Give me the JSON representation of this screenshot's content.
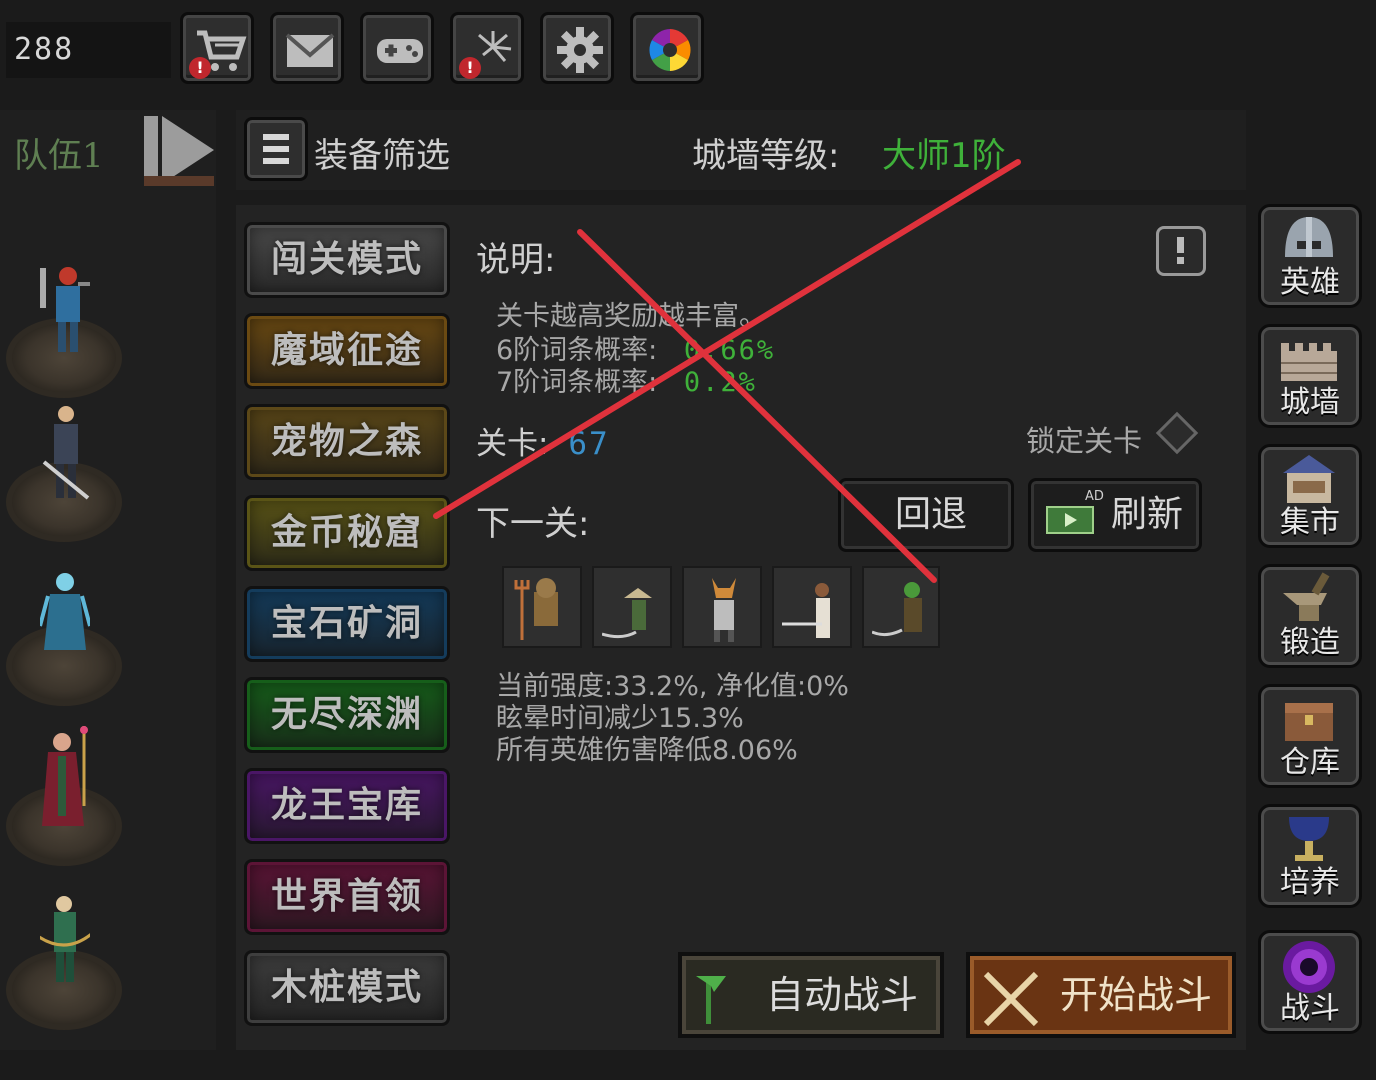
{
  "top": {
    "coins": "288",
    "buttons": [
      {
        "icon": "shop-cart-icon",
        "alert": "!"
      },
      {
        "icon": "mail-icon"
      },
      {
        "icon": "gamepad-icon"
      },
      {
        "icon": "fireworks-icon",
        "alert": "!"
      },
      {
        "icon": "gear-icon"
      },
      {
        "icon": "color-wheel-icon"
      }
    ]
  },
  "team": {
    "label": "队伍1"
  },
  "header": {
    "filter_label": "装备筛选",
    "wall_label": "城墙等级:",
    "wall_value": "大师1阶"
  },
  "modes": [
    {
      "label": "闯关模式",
      "color": "#4a4a4a"
    },
    {
      "label": "魔域征途",
      "color": "#6b4a12"
    },
    {
      "label": "宠物之森",
      "color": "#5c4818"
    },
    {
      "label": "金币秘窟",
      "color": "#5a5416"
    },
    {
      "label": "宝石矿洞",
      "color": "#143c5c"
    },
    {
      "label": "无尽深渊",
      "color": "#165e1a"
    },
    {
      "label": "龙王宝库",
      "color": "#4a1666"
    },
    {
      "label": "世界首领",
      "color": "#5c1436"
    },
    {
      "label": "木桩模式",
      "color": "#3e3e3e"
    }
  ],
  "info": {
    "title": "说明:",
    "line1": "关卡越高奖励越丰富。",
    "line2_label": "6阶词条概率:",
    "line2_value": "0.66%",
    "line3_label": "7阶词条概率:",
    "line3_value": "0.2%",
    "level_label": "关卡:",
    "level_value": "67",
    "lock_label": "锁定关卡",
    "next_label": "下一关:",
    "back_button": "回退",
    "refresh_button": "刷新",
    "ad_badge": "AD",
    "stat1": "当前强度:33.2%, 净化值:0%",
    "stat2": "眩晕时间减少15.3%",
    "stat3": "所有英雄伤害降低8.06%"
  },
  "actions": {
    "auto_battle": "自动战斗",
    "start_battle": "开始战斗"
  },
  "nav": [
    {
      "label": "英雄",
      "icon": "helmet-icon"
    },
    {
      "label": "城墙",
      "icon": "wall-icon"
    },
    {
      "label": "集市",
      "icon": "market-icon"
    },
    {
      "label": "锻造",
      "icon": "anvil-icon"
    },
    {
      "label": "仓库",
      "icon": "chest-icon"
    },
    {
      "label": "培养",
      "icon": "chalice-icon"
    },
    {
      "label": "战斗",
      "icon": "portal-icon"
    }
  ],
  "colors": {
    "accent_green": "#3fb13a",
    "value_blue": "#3a8fc9",
    "annotation_red": "#e0323c"
  }
}
